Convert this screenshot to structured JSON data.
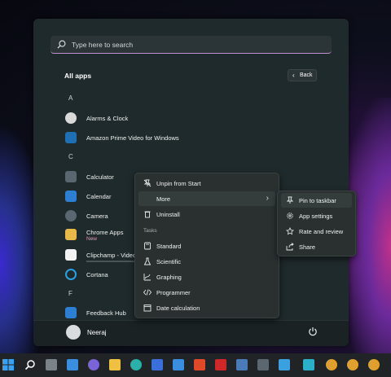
{
  "search": {
    "placeholder": "Type here to search"
  },
  "header": {
    "title": "All apps",
    "back_label": "Back",
    "back_arrow": "‹"
  },
  "letters": {
    "a": "A",
    "c": "C",
    "f": "F"
  },
  "apps": [
    {
      "name": "Alarms & Clock",
      "icon": "clock-icon",
      "color": "#d9d9d9"
    },
    {
      "name": "Amazon Prime Video for Windows",
      "icon": "prime-video-icon",
      "color": "#1f6fb4"
    },
    {
      "name": "Calculator",
      "icon": "calculator-icon",
      "color": "#5b6770"
    },
    {
      "name": "Calendar",
      "icon": "calendar-icon",
      "color": "#2d7fd3"
    },
    {
      "name": "Camera",
      "icon": "camera-icon",
      "color": "#5b6770"
    },
    {
      "name": "Chrome Apps",
      "sub": "New",
      "icon": "folder-icon",
      "color": "#e8b84a"
    },
    {
      "name": "Clipchamp - Video Editor",
      "icon": "clipchamp-icon",
      "color": "#f2f2f2"
    },
    {
      "name": "Cortana",
      "icon": "cortana-icon",
      "color": "#2ba0e0"
    },
    {
      "name": "Feedback Hub",
      "icon": "feedback-hub-icon",
      "color": "#2d7fd3"
    }
  ],
  "user": {
    "name": "Neeraj"
  },
  "context_menu": {
    "unpin": "Unpin from Start",
    "more": "More",
    "more_arrow": "›",
    "uninstall": "Uninstall",
    "tasks_header": "Tasks",
    "tasks": [
      "Standard",
      "Scientific",
      "Graphing",
      "Programmer",
      "Date calculation"
    ]
  },
  "submenu": {
    "items": [
      "Pin to taskbar",
      "App settings",
      "Rate and review",
      "Share"
    ]
  },
  "taskbar": {
    "icons": [
      "start-icon",
      "search-icon",
      "task-view-icon",
      "widgets-icon",
      "chat-icon",
      "file-explorer-icon",
      "edge-icon",
      "store-icon",
      "photos-icon",
      "office-icon",
      "app-icon",
      "app-icon",
      "calculator-icon",
      "notepad-icon",
      "folder-icon",
      "chrome-icon",
      "chrome-icon",
      "chrome-icon"
    ]
  },
  "colors": {
    "accent_underline": "#c090d0",
    "new_badge": "#e898c0"
  }
}
